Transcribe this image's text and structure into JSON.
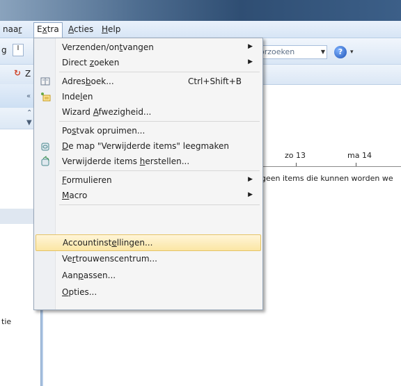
{
  "menubar": {
    "items": [
      {
        "label": "naar",
        "mnemonic_prefix": "naa",
        "mnemonic": "r",
        "suffix": ""
      },
      {
        "label": "Extra",
        "prefix": "E",
        "mnemonic": "x",
        "suffix": "tra"
      },
      {
        "label": "Acties",
        "prefix": "",
        "mnemonic": "A",
        "suffix": "cties"
      },
      {
        "label": "Help",
        "prefix": "",
        "mnemonic": "H",
        "suffix": "elp"
      }
    ]
  },
  "toolbar": {
    "search_placeholder": "orzoeken",
    "left_fragments": [
      "g",
      "I",
      "Z"
    ]
  },
  "calendar": {
    "days": [
      "zo 13",
      "ma 14"
    ],
    "empty_message": "geen items die kunnen worden we"
  },
  "left_label": "tie",
  "menu": {
    "items": [
      {
        "pre": "Verzenden/on",
        "mn": "t",
        "post": "vangen",
        "submenu": true
      },
      {
        "pre": "Direct ",
        "mn": "z",
        "post": "oeken",
        "submenu": true
      },
      {
        "pre": "Adres",
        "mn": "b",
        "post": "oek...",
        "shortcut": "Ctrl+Shift+B",
        "icon": "address-book-icon"
      },
      {
        "pre": "Inde",
        "mn": "l",
        "post": "en",
        "icon": "organize-icon"
      },
      {
        "pre": "Wizard ",
        "mn": "A",
        "post": "fwezigheid..."
      },
      {
        "pre": "Po",
        "mn": "s",
        "post": "tvak opruimen..."
      },
      {
        "pre": "",
        "mn": "D",
        "post": "e map \"Verwijderde items\" leegmaken",
        "icon": "empty-folder-icon"
      },
      {
        "pre": "Verwijderde items ",
        "mn": "h",
        "post": "erstellen...",
        "icon": "recover-items-icon"
      },
      {
        "pre": "",
        "mn": "F",
        "post": "ormulieren",
        "submenu": true
      },
      {
        "pre": "",
        "mn": "M",
        "post": "acro",
        "submenu": true
      },
      {
        "pre": "Accountinst",
        "mn": "e",
        "post": "llingen...",
        "highlighted": true
      },
      {
        "pre": "Ve",
        "mn": "r",
        "post": "trouwenscentrum..."
      },
      {
        "pre": "Aan",
        "mn": "p",
        "post": "assen..."
      },
      {
        "pre": "",
        "mn": "O",
        "post": "pties..."
      }
    ]
  },
  "icons": {
    "help": "?",
    "submenu_arrow": "▶",
    "dropdown_arrow": "▼"
  }
}
